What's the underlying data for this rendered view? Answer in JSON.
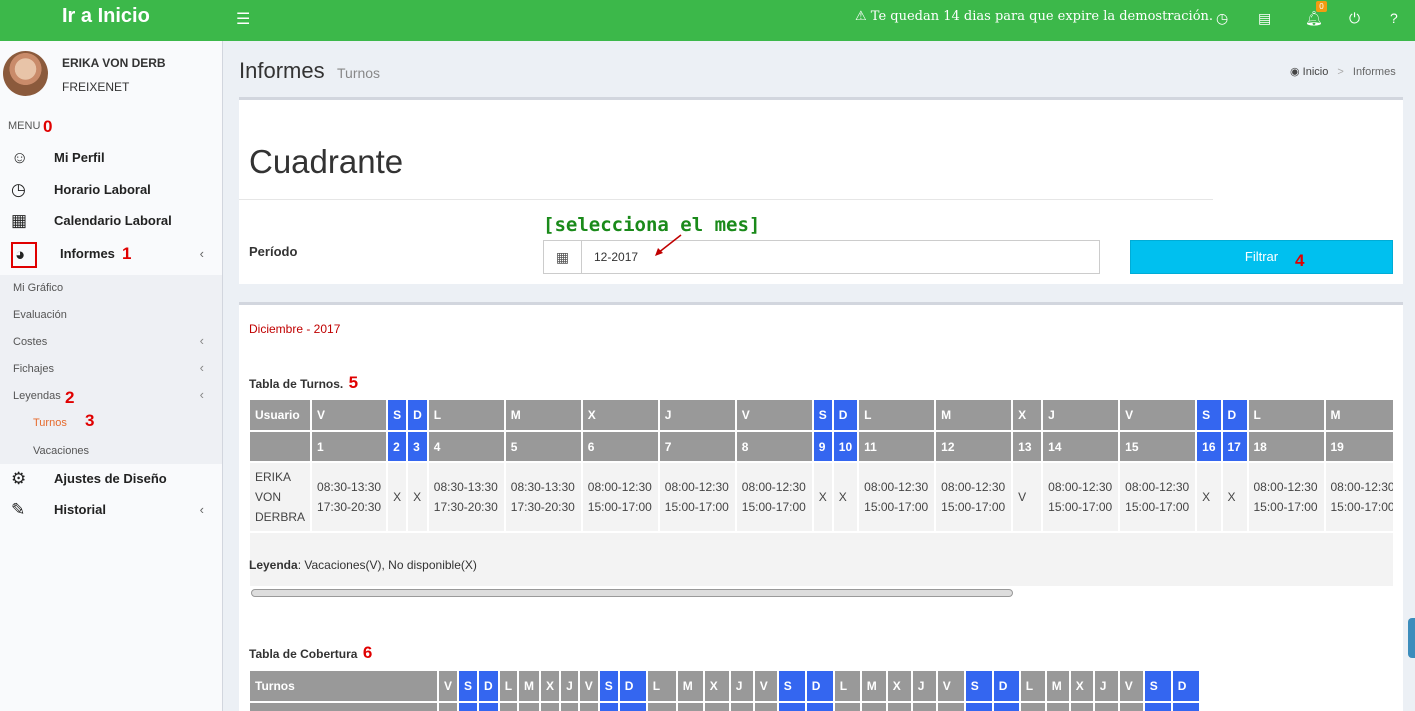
{
  "topbar": {
    "brand": "Ir a Inicio",
    "menu_icon": "hamburger-icon",
    "demo_message": "Te quedan 14 dias para que expire la demostración.",
    "notification_count": "0",
    "icons": [
      "warning-icon",
      "clock-icon",
      "card-icon",
      "bell-icon",
      "power-icon",
      "help-icon"
    ]
  },
  "sidebar": {
    "user_name": "ERIKA VON DERB",
    "user_company": "FREIXENET",
    "menu_header": "MENU",
    "items": [
      {
        "label": "Mi Perfil",
        "icon": "smile-icon"
      },
      {
        "label": "Horario Laboral",
        "icon": "clock-icon"
      },
      {
        "label": "Calendario Laboral",
        "icon": "calendar-icon"
      },
      {
        "label": "Informes",
        "icon": "pie-chart-icon"
      },
      {
        "label": "Ajustes de Diseño",
        "icon": "gear-icon"
      },
      {
        "label": "Historial",
        "icon": "edit-icon"
      }
    ],
    "submenu": [
      "Mi Gráfico",
      "Evaluación",
      "Costes",
      "Fichajes",
      "Leyendas"
    ],
    "subsubmenu": [
      "Turnos",
      "Vacaciones"
    ]
  },
  "annotations": {
    "a0": "0",
    "a1": "1",
    "a2": "2",
    "a3": "3",
    "a4": "4",
    "a5": "5",
    "a6": "6"
  },
  "header": {
    "title": "Informes",
    "subtitle": "Turnos",
    "breadcrumb_home": "Inicio",
    "breadcrumb_sep": ">",
    "breadcrumb_current": "Informes"
  },
  "filter": {
    "heading": "Cuadrante",
    "period_label": "Período",
    "hint": "[selecciona el mes]",
    "period_value": "12-2017",
    "button": "Filtrar"
  },
  "report": {
    "month": "Diciembre - 2017",
    "shifts_title": "Tabla de Turnos.",
    "legend_label": "Leyenda",
    "legend_text": ": Vacaciones(V), No disponible(X)",
    "coverage_title": "Tabla de Cobertura",
    "user_header": "Usuario",
    "coverage_header": "Turnos",
    "employee": [
      "ERIKA",
      "VON",
      "DERBRA"
    ],
    "days": [
      {
        "d": "V",
        "n": "1",
        "we": false,
        "s": [
          "08:30-13:30",
          "17:30-20:30"
        ]
      },
      {
        "d": "S",
        "n": "2",
        "we": true,
        "s": [
          "X"
        ]
      },
      {
        "d": "D",
        "n": "3",
        "we": true,
        "s": [
          "X"
        ]
      },
      {
        "d": "L",
        "n": "4",
        "we": false,
        "s": [
          "08:30-13:30",
          "17:30-20:30"
        ]
      },
      {
        "d": "M",
        "n": "5",
        "we": false,
        "s": [
          "08:30-13:30",
          "17:30-20:30"
        ]
      },
      {
        "d": "X",
        "n": "6",
        "we": false,
        "s": [
          "08:00-12:30",
          "15:00-17:00"
        ]
      },
      {
        "d": "J",
        "n": "7",
        "we": false,
        "s": [
          "08:00-12:30",
          "15:00-17:00"
        ]
      },
      {
        "d": "V",
        "n": "8",
        "we": false,
        "s": [
          "08:00-12:30",
          "15:00-17:00"
        ]
      },
      {
        "d": "S",
        "n": "9",
        "we": true,
        "s": [
          "X"
        ]
      },
      {
        "d": "D",
        "n": "10",
        "we": true,
        "s": [
          "X"
        ]
      },
      {
        "d": "L",
        "n": "11",
        "we": false,
        "s": [
          "08:00-12:30",
          "15:00-17:00"
        ]
      },
      {
        "d": "M",
        "n": "12",
        "we": false,
        "s": [
          "08:00-12:30",
          "15:00-17:00"
        ]
      },
      {
        "d": "X",
        "n": "13",
        "we": false,
        "s": [
          "V"
        ]
      },
      {
        "d": "J",
        "n": "14",
        "we": false,
        "s": [
          "08:00-12:30",
          "15:00-17:00"
        ]
      },
      {
        "d": "V",
        "n": "15",
        "we": false,
        "s": [
          "08:00-12:30",
          "15:00-17:00"
        ]
      },
      {
        "d": "S",
        "n": "16",
        "we": true,
        "s": [
          "X"
        ]
      },
      {
        "d": "D",
        "n": "17",
        "we": true,
        "s": [
          "X"
        ]
      },
      {
        "d": "L",
        "n": "18",
        "we": false,
        "s": [
          "08:00-12:30",
          "15:00-17:00"
        ]
      },
      {
        "d": "M",
        "n": "19",
        "we": false,
        "s": [
          "08:00-12:30",
          "15:00-17:00"
        ]
      }
    ],
    "coverage_days": [
      {
        "d": "V",
        "we": false
      },
      {
        "d": "S",
        "we": true
      },
      {
        "d": "D",
        "we": true
      },
      {
        "d": "L",
        "we": false
      },
      {
        "d": "M",
        "we": false
      },
      {
        "d": "X",
        "we": false
      },
      {
        "d": "J",
        "we": false
      },
      {
        "d": "V",
        "we": false
      },
      {
        "d": "S",
        "we": true
      },
      {
        "d": "D",
        "we": true
      },
      {
        "d": "L",
        "we": false
      },
      {
        "d": "M",
        "we": false
      },
      {
        "d": "X",
        "we": false
      },
      {
        "d": "J",
        "we": false
      },
      {
        "d": "V",
        "we": false
      },
      {
        "d": "S",
        "we": true
      },
      {
        "d": "D",
        "we": true
      },
      {
        "d": "L",
        "we": false
      },
      {
        "d": "M",
        "we": false
      },
      {
        "d": "X",
        "we": false
      },
      {
        "d": "J",
        "we": false
      },
      {
        "d": "V",
        "we": false
      },
      {
        "d": "S",
        "we": true
      },
      {
        "d": "D",
        "we": true
      },
      {
        "d": "L",
        "we": false
      },
      {
        "d": "M",
        "we": false
      },
      {
        "d": "X",
        "we": false
      },
      {
        "d": "J",
        "we": false
      },
      {
        "d": "V",
        "we": false
      },
      {
        "d": "S",
        "we": true
      },
      {
        "d": "D",
        "we": true
      }
    ]
  },
  "colors": {
    "topbar": "#3cb84a",
    "weekend_header": "#3466f0",
    "header": "#999999",
    "filter_button": "#00c0ef",
    "annotation": "#e00000",
    "hint": "#1a8a1a"
  }
}
